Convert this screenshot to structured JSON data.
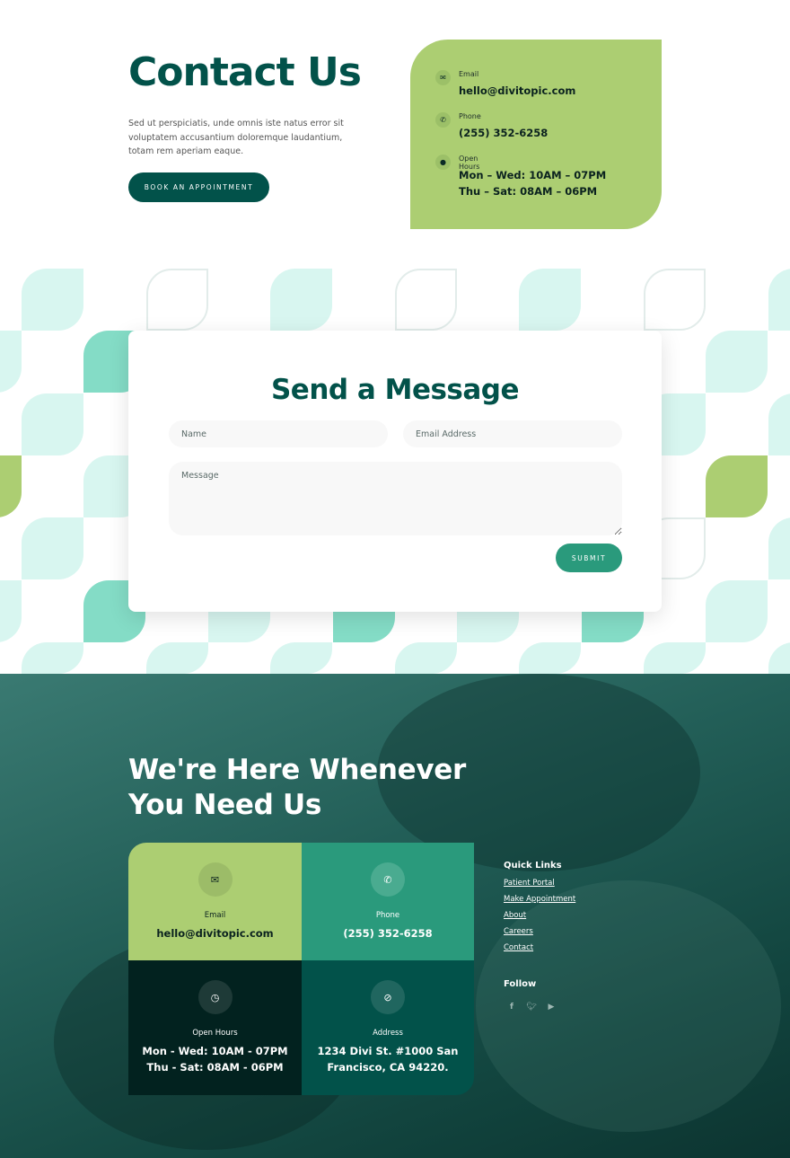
{
  "hero": {
    "title": "Contact Us",
    "intro": "Sed ut perspiciatis, unde omnis iste natus error sit voluptatem accusantium doloremque laudantium, totam rem aperiam eaque.",
    "button": "BOOK AN APPOINTMENT"
  },
  "contact_card": {
    "email_label": "Email",
    "email": "hello@divitopic.com",
    "phone_label": "Phone",
    "phone": "(255) 352-6258",
    "hours_label": "Open Hours",
    "hours_1": "Mon – Wed: 10AM – 07PM",
    "hours_2": "Thu – Sat: 08AM – 06PM"
  },
  "form": {
    "title": "Send a Message",
    "name_placeholder": "Name",
    "email_placeholder": "Email Address",
    "message_placeholder": "Message",
    "submit": "SUBMIT"
  },
  "footer": {
    "title_1": "We're Here Whenever",
    "title_2": "You Need Us",
    "cells": {
      "email": {
        "label": "Email",
        "value": "hello@divitopic.com"
      },
      "phone": {
        "label": "Phone",
        "value": "(255) 352-6258"
      },
      "hours": {
        "label": "Open Hours",
        "value_1": "Mon - Wed: 10AM - 07PM",
        "value_2": "Thu - Sat: 08AM - 06PM"
      },
      "address": {
        "label": "Address",
        "value_1": "1234 Divi St. #1000 San",
        "value_2": "Francisco, CA 94220."
      }
    },
    "quick_links_title": "Quick Links",
    "quick_links": [
      "Patient Portal",
      "Make Appointment",
      "About",
      "Careers",
      "Contact"
    ],
    "follow_title": "Follow",
    "social": [
      "facebook-icon",
      "twitter-icon",
      "youtube-icon"
    ]
  },
  "colors": {
    "primary": "#02524a",
    "green": "#acce72",
    "teal": "#2a9a7c",
    "dark": "#02221f",
    "light_tile": "#d8f6f0",
    "mid_tile": "#84dcc6"
  }
}
